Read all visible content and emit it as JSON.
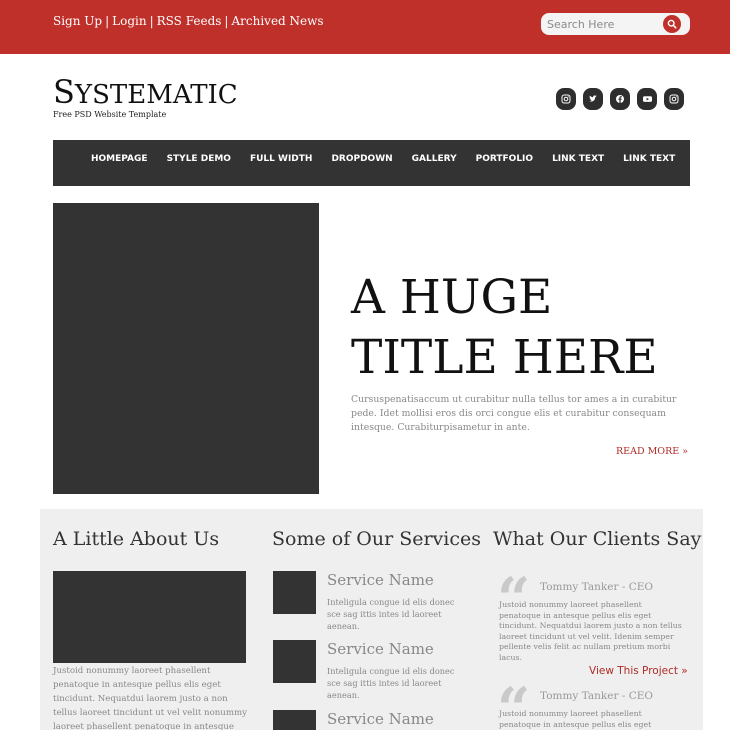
{
  "topbar": {
    "links": [
      "Sign Up",
      "Login",
      "RSS Feeds",
      "Archived News"
    ],
    "separator": "|",
    "search_placeholder": "Search Here",
    "search_icon": "search-icon",
    "color": "#c0302b"
  },
  "logo": {
    "first_letter": "S",
    "rest": "YSTEMATIC",
    "tagline": "Free PSD Website Template"
  },
  "socials": [
    "instagram-icon",
    "twitter-icon",
    "facebook-icon",
    "youtube-icon",
    "instagram-icon"
  ],
  "nav": {
    "items": [
      "HOMEPAGE",
      "STYLE DEMO",
      "FULL WIDTH",
      "DROPDOWN",
      "GALLERY",
      "PORTFOLIO",
      "LINK TEXT",
      "LINK TEXT"
    ]
  },
  "hero": {
    "title_line1": "A HUGE",
    "title_line2": "TITLE HERE",
    "text": "Cursuspenatisaccum ut curabitur nulla tellus tor ames a in curabitur pede. Idet mollisi eros dis orci congue elis et curabitur consequam intesque. Curabiturpisametur in ante.",
    "read_more": "READ MORE »"
  },
  "about": {
    "title": "A Little About Us",
    "text": "Justoid nonummy laoreet phasellent penatoque in antesque pellus elis eget tincidunt. Nequatdui laorem justo a non tellus laoreet tincidunt ut vel velit nonummy laoreet phasellent penatoque in antesque pellus elis eget tincidunt."
  },
  "services": {
    "title": "Some of Our Services",
    "items": [
      {
        "name": "Service Name",
        "desc": "Inteligula congue id elis donec sce sag ittis intes id laoreet aenean."
      },
      {
        "name": "Service Name",
        "desc": "Inteligula congue id elis donec sce sag ittis intes id laoreet aenean."
      },
      {
        "name": "Service Name",
        "desc": ""
      }
    ]
  },
  "clients": {
    "title": "What Our Clients Say",
    "quote_mark": "“",
    "items": [
      {
        "name": "Tommy Tanker - CEO",
        "text": "Justoid nonummy laoreet phasellent penatoque in antesque pellus elis eget tincidunt. Nequatdui laorem justo a non tellus laoreet tincidunt ut vel velit. Idenim semper pellente velis felit ac nullam pretium morbi lacus."
      },
      {
        "name": "Tommy Tanker - CEO",
        "text": "Justoid nonummy laoreet phasellent penatoque in antesque pellus elis eget tincidunt. Nequatdui"
      }
    ],
    "view_project": "View This Project »"
  }
}
